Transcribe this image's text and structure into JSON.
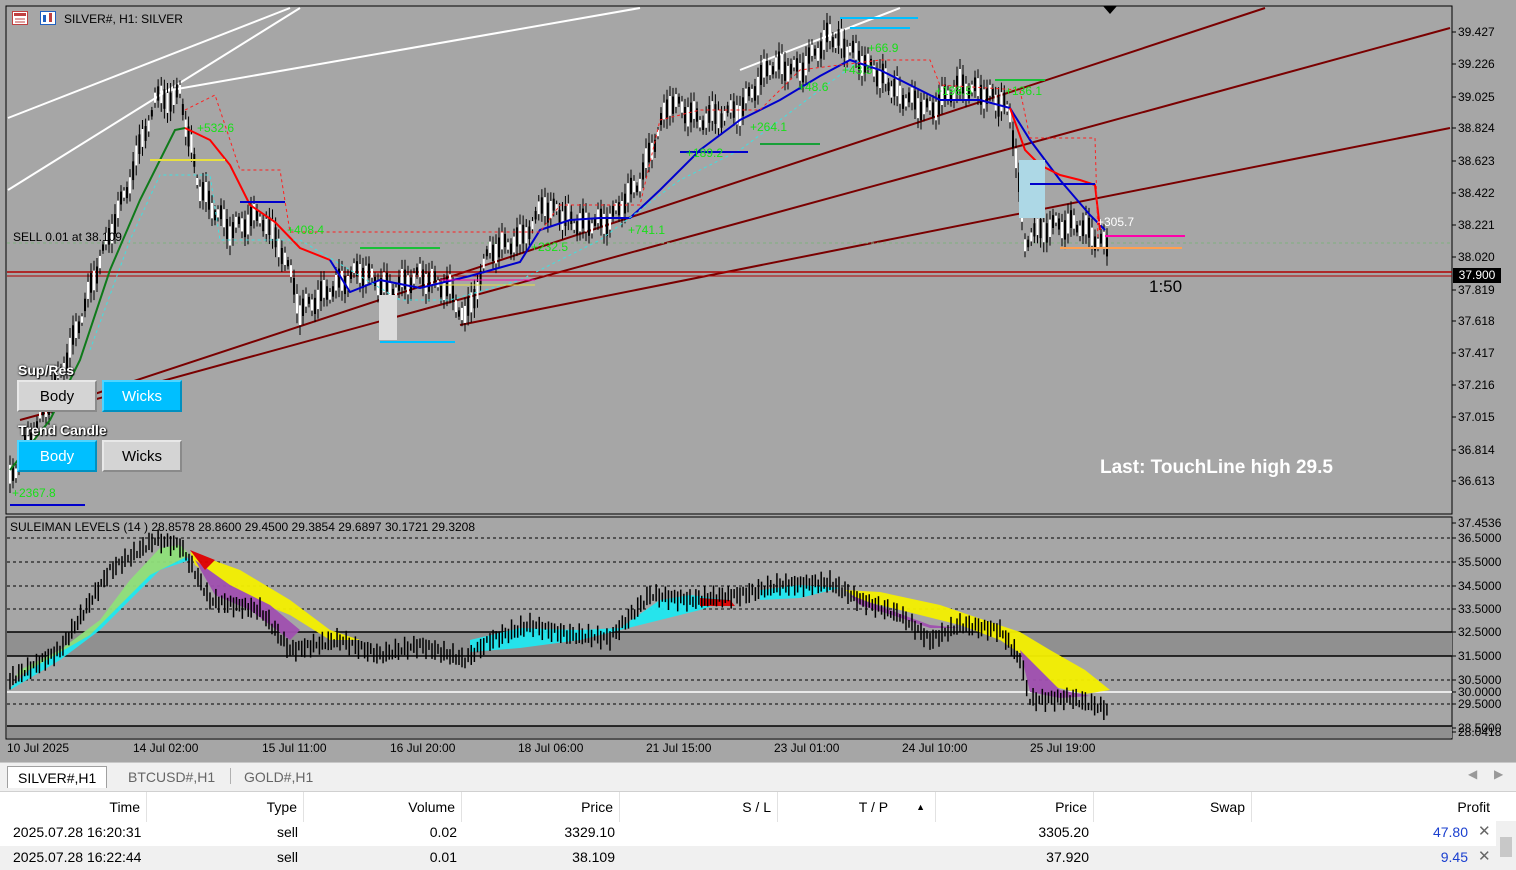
{
  "chart": {
    "title": "SILVER#, H1:  SILVER",
    "price_ticks": [
      "39.427",
      "39.226",
      "39.025",
      "38.824",
      "38.623",
      "38.422",
      "38.221",
      "38.020",
      "37.819",
      "37.618",
      "37.417",
      "37.216",
      "37.015",
      "36.814",
      "36.613"
    ],
    "current_price": "37.900",
    "sell_label": "SELL 0.01 at 38.109",
    "leverage_label": "1:50",
    "last_touch": "Last: TouchLine high 29.5",
    "annotations": [
      "+532.6",
      "+408.4",
      "+232.5",
      "+741.1",
      "+189.2",
      "+264.1",
      "+48.6",
      "+43.5",
      "+66.9",
      "+198.5",
      "+136.1",
      "+305.7",
      "+2367.8"
    ]
  },
  "indicator": {
    "title": "SULEIMAN LEVELS (14 )  28.8578 28.8600 29.4500 29.3854 29.6897 30.1721 29.3208",
    "ticks": [
      "37.4536",
      "36.5000",
      "35.5000",
      "34.5000",
      "33.5000",
      "32.5000",
      "31.5000",
      "30.5000",
      "30.0000",
      "29.5000",
      "28.5000",
      "28.0418"
    ]
  },
  "time_axis": [
    "10 Jul 2025",
    "14 Jul 02:00",
    "15 Jul 11:00",
    "16 Jul 20:00",
    "18 Jul 06:00",
    "21 Jul 15:00",
    "23 Jul 01:00",
    "24 Jul 10:00",
    "25 Jul 19:00"
  ],
  "panel": {
    "supres_label": "Sup/Res",
    "trend_label": "Trend Candle",
    "body_label": "Body",
    "wicks_label": "Wicks",
    "supres_active": "wicks",
    "trend_active": "body",
    "active_color": "#00bfff"
  },
  "tabs": [
    "SILVER#,H1",
    "BTCUSD#,H1",
    "GOLD#,H1"
  ],
  "trade_table": {
    "headers": [
      "Time",
      "Type",
      "Volume",
      "Price",
      "S / L",
      "T / P",
      "Price",
      "Swap",
      "Profit"
    ],
    "rows": [
      {
        "time": "2025.07.28 16:20:31",
        "type": "sell",
        "volume": "0.02",
        "price": "3329.10",
        "sl": "",
        "tp": "",
        "current": "3305.20",
        "swap": "",
        "profit": "47.80"
      },
      {
        "time": "2025.07.28 16:22:44",
        "type": "sell",
        "volume": "0.01",
        "price": "38.109",
        "sl": "",
        "tp": "",
        "current": "37.920",
        "swap": "",
        "profit": "9.45"
      }
    ]
  }
}
